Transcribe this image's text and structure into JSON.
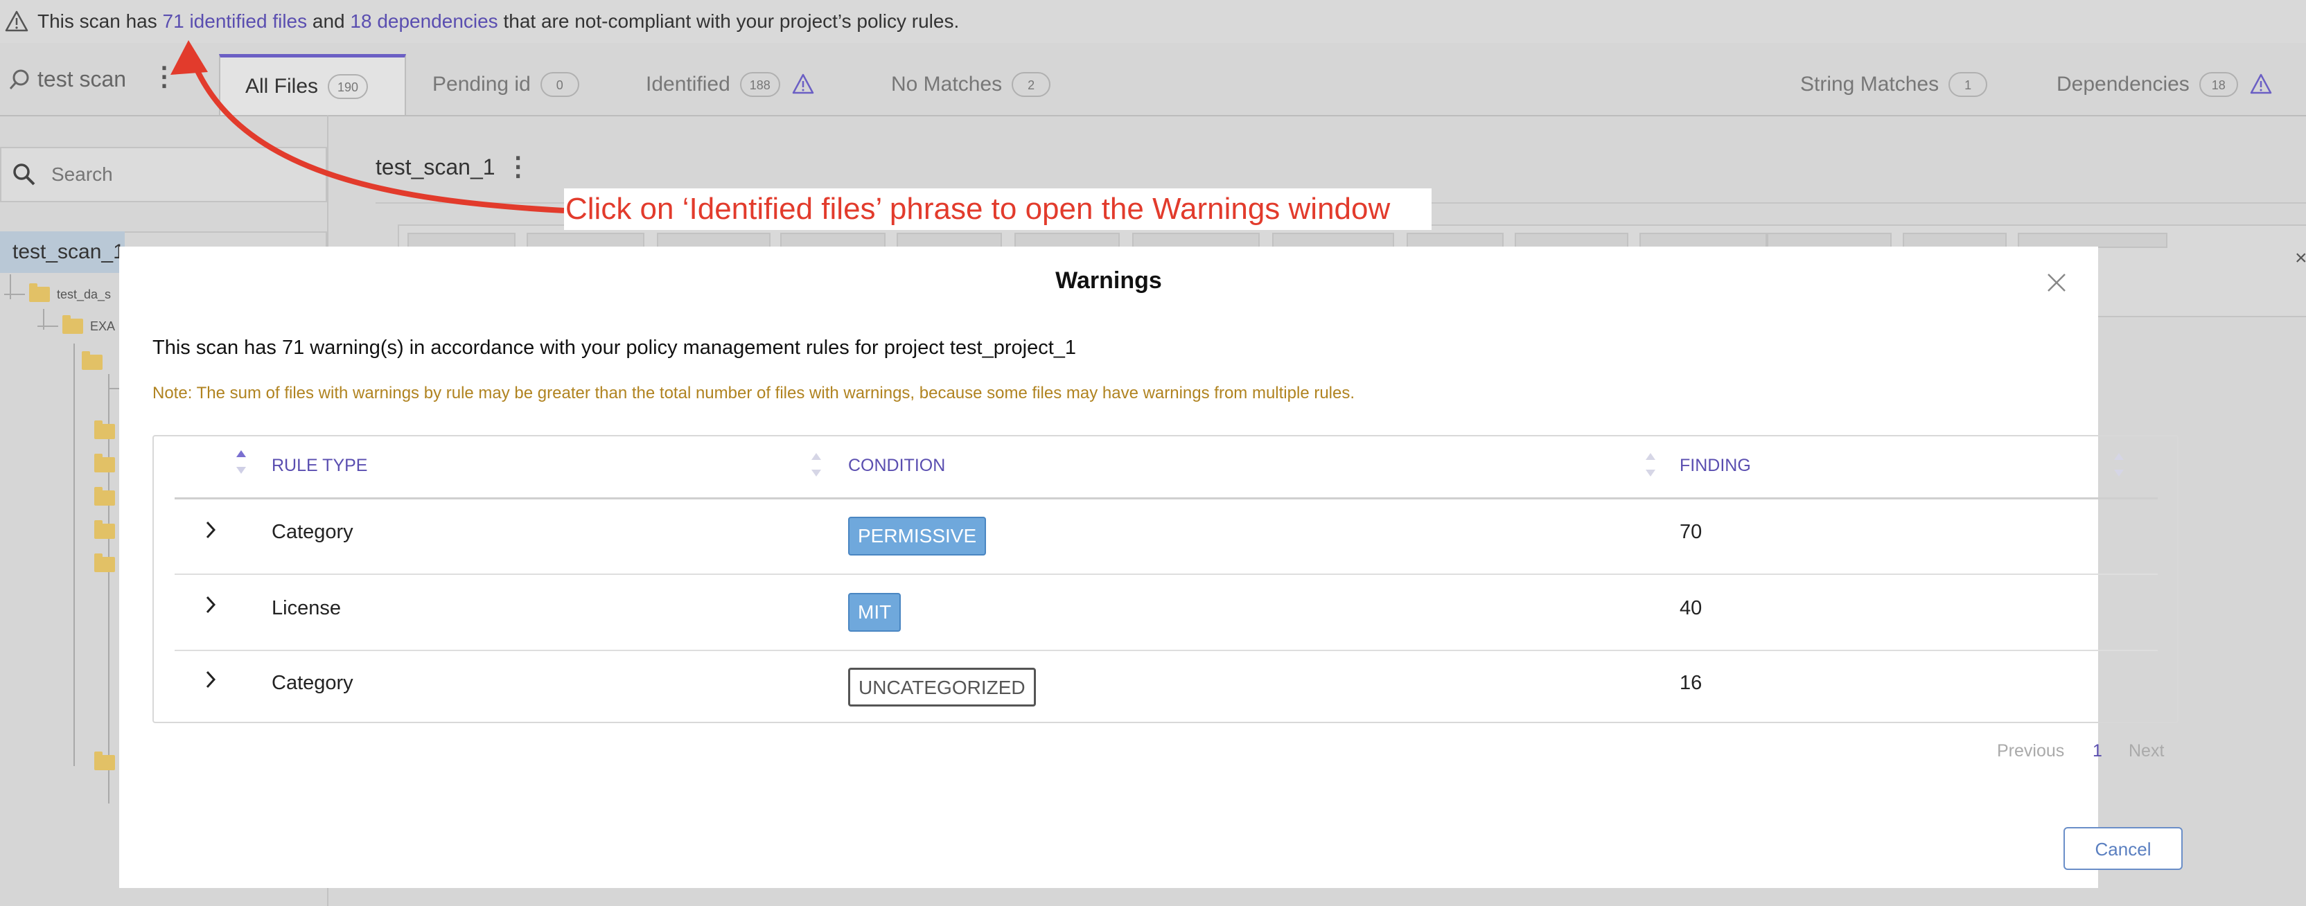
{
  "banner": {
    "prefix": "This scan has ",
    "files_link": "71 identified files",
    "middle": " and ",
    "deps_link": "18 dependencies",
    "suffix": " that are not-compliant with your project’s policy rules."
  },
  "scan": {
    "name": "test scan"
  },
  "tabs": [
    {
      "label": "All Files",
      "count": "190",
      "active": true
    },
    {
      "label": "Pending id",
      "count": "0"
    },
    {
      "label": "Identified",
      "count": "188",
      "warning": true
    },
    {
      "label": "No Matches",
      "count": "2"
    },
    {
      "label": "String Matches",
      "count": "1"
    },
    {
      "label": "Dependencies",
      "count": "18",
      "warning": true
    }
  ],
  "sidebar": {
    "search_placeholder": "Search",
    "tree": [
      {
        "label": "test_scan_1"
      },
      {
        "label": "test_da_s"
      },
      {
        "label": "EXA"
      }
    ]
  },
  "content": {
    "breadcrumb": "test_scan_1"
  },
  "annotation": {
    "text": "Click on ‘Identified files’ phrase to open the Warnings window"
  },
  "modal": {
    "title": "Warnings",
    "summary": "This scan has 71 warning(s) in accordance with your policy management rules for project test_project_1",
    "note": "Note: The sum of files with warnings by rule may be greater than the total number of files with warnings, because some files may have warnings from multiple rules.",
    "columns": [
      "RULE TYPE",
      "CONDITION",
      "FINDING"
    ],
    "rows": [
      {
        "rule_type": "Category",
        "condition": "PERMISSIVE",
        "finding": "70"
      },
      {
        "rule_type": "License",
        "condition": "MIT",
        "finding": "40"
      },
      {
        "rule_type": "Category",
        "condition": "UNCATEGORIZED",
        "finding": "16"
      }
    ],
    "pagination": {
      "previous": "Previous",
      "page": "1",
      "next": "Next"
    },
    "cancel_label": "Cancel"
  },
  "colors": {
    "accent": "#5a4eb0",
    "annotation": "#e23b2c",
    "chip_blue": "#6fa8dc",
    "note": "#b08320"
  },
  "icons": [
    "warning-icon",
    "search-icon",
    "kebab-icon",
    "folder-icon",
    "close-icon",
    "chevron-right-icon",
    "sort-icon"
  ]
}
